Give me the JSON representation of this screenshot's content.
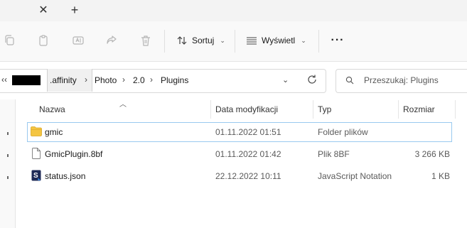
{
  "tabbar": {
    "close_label": "✕",
    "new_tab_label": "+"
  },
  "toolbar": {
    "sort_label": "Sortuj",
    "view_label": "Wyświetl",
    "more_label": "···"
  },
  "breadcrumb": {
    "ellipsis": "‹‹",
    "segments": [
      ".affinity",
      "Photo",
      "2.0",
      "Plugins"
    ],
    "separator": "›"
  },
  "search": {
    "placeholder": "Przeszukaj: Plugins"
  },
  "columns": {
    "name": "Nazwa",
    "date": "Data modyfikacji",
    "type": "Typ",
    "size": "Rozmiar"
  },
  "files": [
    {
      "name": "gmic",
      "date": "01.11.2022 01:51",
      "type": "Folder plików",
      "size": "",
      "icon": "folder-icon"
    },
    {
      "name": "GmicPlugin.8bf",
      "date": "01.11.2022 01:42",
      "type": "Plik 8BF",
      "size": "3 266 KB",
      "icon": "file-icon"
    },
    {
      "name": "status.json",
      "date": "22.12.2022 10:11",
      "type": "JavaScript Notation",
      "size": "1 KB",
      "icon": "json-file-icon"
    }
  ],
  "colors": {
    "accent": "#0067c0",
    "selection_border": "#99c9ef",
    "folder": "#f4c542"
  }
}
